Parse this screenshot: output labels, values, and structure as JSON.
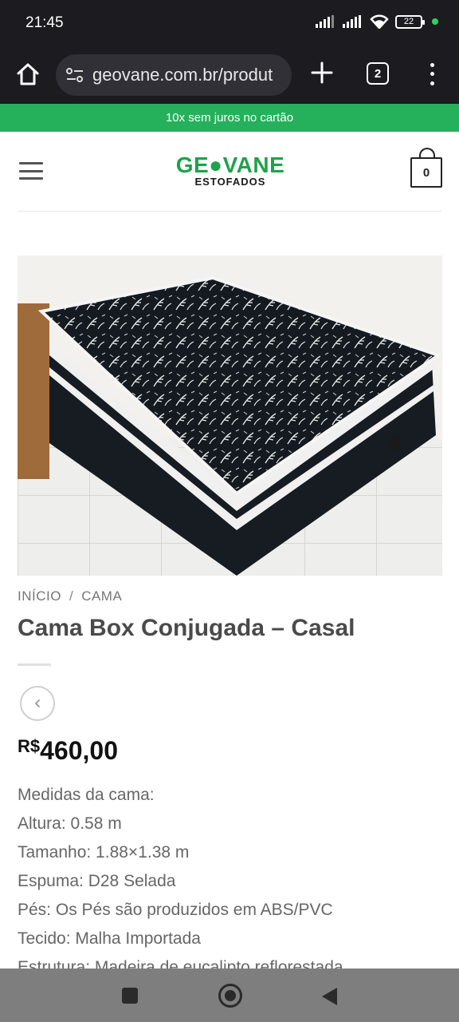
{
  "status_bar": {
    "time": "21:45",
    "battery": "22"
  },
  "browser": {
    "url": "geovane.com.br/produt",
    "tab_count": "2"
  },
  "promo": {
    "text": "10x sem juros no cartão"
  },
  "header": {
    "logo_main": "GE●VANE",
    "logo_sub": "ESTOFADOS",
    "cart_count": "0"
  },
  "breadcrumb": {
    "home": "INÍCIO",
    "separator": "/",
    "category": "CAMA"
  },
  "product": {
    "title": "Cama Box Conjugada – Casal",
    "currency": "R$",
    "price": "460,00",
    "specs": [
      "Medidas da cama:",
      "Altura: 0.58 m",
      "Tamanho: 1.88×1.38 m",
      "Espuma: D28 Selada",
      "Pés: Os Pés são produzidos em ABS/PVC",
      "Tecido: Malha Importada",
      "Estrutura: Madeira de eucalipto reflorestada"
    ]
  },
  "colors": {
    "brand_green": "#1fa24a",
    "promo_green": "#25b15b"
  }
}
